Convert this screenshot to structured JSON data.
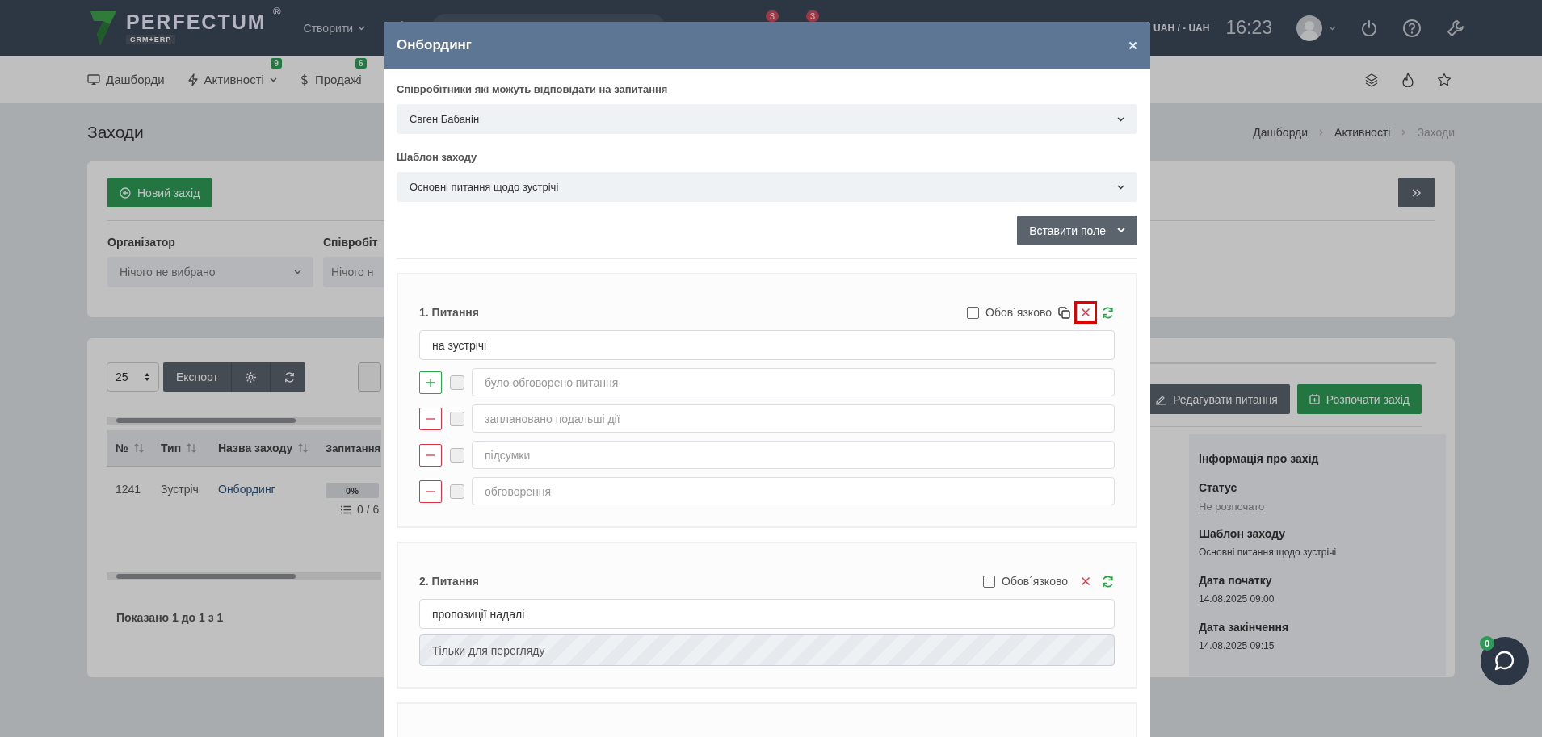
{
  "topbar": {
    "logo": {
      "name": "PERFECTUM",
      "mark": "®",
      "sub": "CRM+ERP"
    },
    "create_menu": "Створити",
    "badges": [
      "3",
      "3"
    ],
    "currency": "UAH / - UAH",
    "time": "16:23"
  },
  "navbar": {
    "items": [
      {
        "label": "Дашборди"
      },
      {
        "label": "Активності",
        "badge": "9",
        "dropdown": true
      },
      {
        "label": "Продажі",
        "badge": "6"
      }
    ]
  },
  "page": {
    "title": "Заходи",
    "breadcrumbs": [
      {
        "label": "Дашборди",
        "current": false
      },
      {
        "label": "Активності",
        "current": false
      },
      {
        "label": "Заходи",
        "current": true
      }
    ]
  },
  "filters": {
    "new_button": "Новий захід",
    "fields": [
      {
        "label": "Організатор",
        "placeholder": "Нічого не вибрано"
      },
      {
        "label": "Співробіт",
        "placeholder": "Нічого н"
      }
    ]
  },
  "table": {
    "page_size": "25",
    "export": "Експорт",
    "columns": [
      {
        "label": "№",
        "sortable": true
      },
      {
        "label": "Тип",
        "sortable": true
      },
      {
        "label": "Назва заходу",
        "sortable": true
      },
      {
        "label": "Запитання",
        "sortable": false
      }
    ],
    "rows": [
      {
        "number": "1241",
        "type": "Зустріч",
        "name": "Онбординг",
        "progress": "0%",
        "level": 0,
        "count": "0 / 6"
      }
    ],
    "footer": "Показано 1 до 1 з 1"
  },
  "actions": [
    {
      "label": "Редагувати питання",
      "kind": "secondary"
    },
    {
      "label": "Розпочати захід",
      "kind": "primary"
    }
  ],
  "event_info": {
    "title": "Інформація про захід",
    "fields": [
      {
        "label": "Статус",
        "value": "Не розпочато",
        "kind": "status"
      },
      {
        "label": "Шаблон заходу",
        "value": "Основні питання щодо зустрічі",
        "kind": "text"
      },
      {
        "label": "Дата початку",
        "value": "14.08.2025 09:00",
        "kind": "text"
      },
      {
        "label": "Дата закінчення",
        "value": "14.08.2025 09:15",
        "kind": "text"
      }
    ]
  },
  "chat": {
    "badge": "0"
  },
  "modal": {
    "title": "Онбординг",
    "fields": [
      {
        "label": "Співробітники які можуть відповідати на запитання",
        "value": "Євген Бабанін"
      },
      {
        "label": "Шаблон заходу",
        "value": "Основні питання щодо зустрічі"
      }
    ],
    "insert_button": "Вставити поле",
    "questions": [
      {
        "title": "1. Питання",
        "required_label": "Обов´язково",
        "required": false,
        "copyable": true,
        "highlighted": true,
        "text": "на зустрічі",
        "kind": "options",
        "options": [
          {
            "kind": "add",
            "checked": false,
            "placeholder": "було обговорено питання"
          },
          {
            "kind": "remove",
            "checked": false,
            "placeholder": "заплановано подальші дії"
          },
          {
            "kind": "remove",
            "checked": false,
            "placeholder": "підсумки"
          },
          {
            "kind": "remove",
            "checked": false,
            "placeholder": "обговорення"
          }
        ]
      },
      {
        "title": "2. Питання",
        "required_label": "Обов´язково",
        "required": false,
        "copyable": false,
        "highlighted": false,
        "text": "пропозиції надалі",
        "kind": "readonly",
        "answer": "Тільки для перегляду"
      }
    ]
  }
}
